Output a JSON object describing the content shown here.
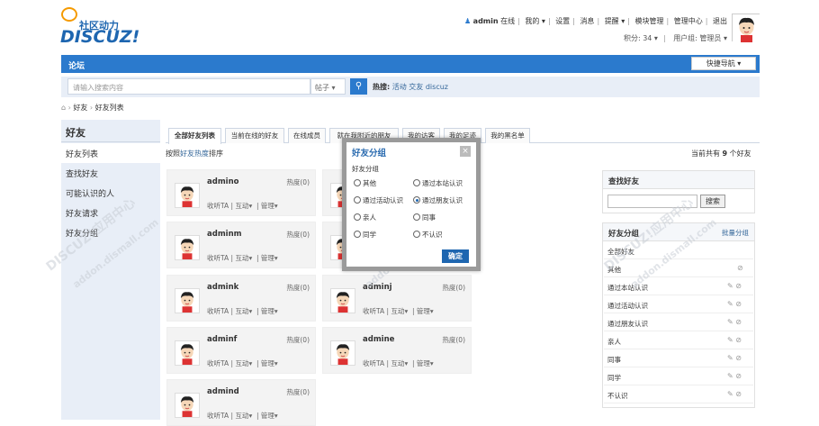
{
  "header": {
    "logo_cn": "社区动力",
    "logo_en": "DISCUZ!",
    "user": "admin",
    "online": "在线",
    "links": [
      "我的",
      "设置",
      "消息",
      "提醒",
      "模块管理",
      "管理中心",
      "退出"
    ],
    "points_label": "积分: 34",
    "group_label": "用户组: 管理员"
  },
  "nav": {
    "title": "论坛",
    "quick_nav": "快捷导航"
  },
  "search": {
    "placeholder": "请输入搜索内容",
    "type": "帖子",
    "hot_label": "热搜:",
    "hot_words": [
      "活动",
      "交友",
      "discuz"
    ]
  },
  "breadcrumb": {
    "sep": "›",
    "items": [
      "好友",
      "好友列表"
    ]
  },
  "sidebar": {
    "title": "好友",
    "items": [
      "好友列表",
      "查找好友",
      "可能认识的人",
      "好友请求",
      "好友分组"
    ]
  },
  "tabs": [
    "全部好友列表",
    "当前在线的好友",
    "在线成员",
    "就在我附近的朋友",
    "我的访客",
    "我的足迹",
    "我的黑名单"
  ],
  "sort": {
    "prefix": "按照",
    "link": "好友热度",
    "suffix": "排序"
  },
  "count": {
    "prefix": "当前共有",
    "num": "9",
    "suffix": "个好友"
  },
  "friends": [
    {
      "name": "admino",
      "heat": "热度(0)"
    },
    {
      "name": "adminm",
      "heat": "热度(0)"
    },
    {
      "name": "admink",
      "heat": "热度(0)"
    },
    {
      "name": "adminj",
      "heat": "热度(0)"
    },
    {
      "name": "adminf",
      "heat": "热度(0)"
    },
    {
      "name": "admine",
      "heat": "热度(0)"
    },
    {
      "name": "admind",
      "heat": "热度(0)"
    }
  ],
  "card_actions": {
    "follow": "收听TA",
    "interact": "互动",
    "manage": "管理"
  },
  "find_box": {
    "title": "查找好友",
    "button": "搜索"
  },
  "group_box": {
    "title": "好友分组",
    "batch": "批量分组",
    "groups": [
      "全部好友",
      "其他",
      "通过本站认识",
      "通过活动认识",
      "通过朋友认识",
      "亲人",
      "同事",
      "同学",
      "不认识"
    ]
  },
  "modal": {
    "title": "好友分组",
    "close": "×",
    "subtitle": "好友分组",
    "options": [
      "其他",
      "通过本站认识",
      "通过活动认识",
      "通过朋友认识",
      "亲人",
      "同事",
      "同学",
      "不认识"
    ],
    "selected": "通过朋友认识",
    "ok": "确定"
  },
  "watermark": {
    "text1": "DISCUZ!应用中心",
    "text2": "addon.dismall.com"
  }
}
